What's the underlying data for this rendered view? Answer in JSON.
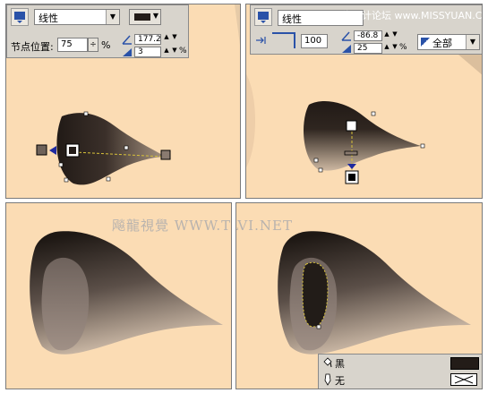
{
  "panel1": {
    "toolbar": {
      "fill_type": "线性",
      "node_position_label": "节点位置:",
      "node_position_value": "75",
      "percent_unit": "%",
      "angle_value": "177.2",
      "edge_pad_value": "3",
      "edge_pad_unit": "%"
    }
  },
  "panel2": {
    "toolbar": {
      "fill_type": "线性",
      "steps_value": "100",
      "angle_value": "-86.8",
      "edge_pad_value": "25",
      "edge_pad_unit": "%",
      "apply_scope": "全部"
    }
  },
  "watermark_site": "思缘设计论坛 www.MISSYUAN.COM",
  "watermark_main": "飚龍視覺 WWW.TLVI.NET",
  "legend": {
    "fill_name": "黑",
    "outline_name": "无"
  },
  "colors": {
    "canvas_bg": "#fbdcb4",
    "ui_gray": "#d8d4cc",
    "fill_dark": "#231c18",
    "fill_light": "#c8b4a0"
  }
}
